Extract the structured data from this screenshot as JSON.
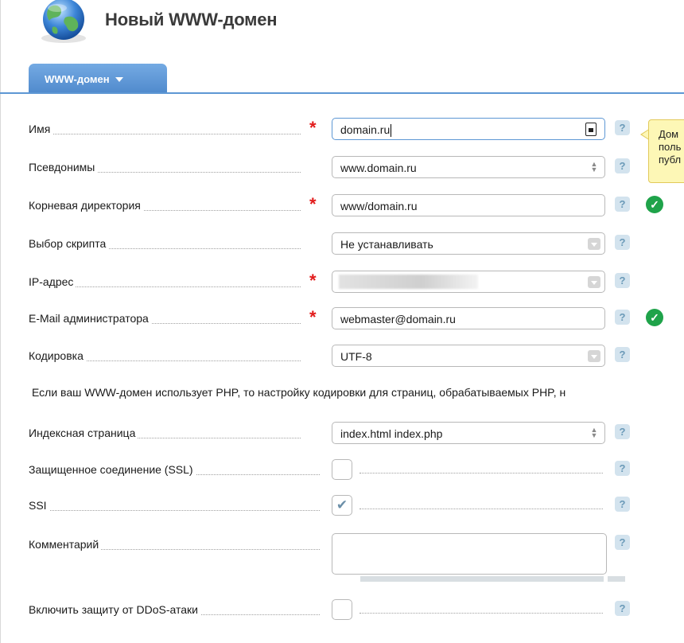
{
  "header": {
    "title": "Новый WWW-домен",
    "icon": "globe-icon"
  },
  "tab": {
    "label": "WWW-домен"
  },
  "form": {
    "name": {
      "label": "Имя",
      "value": "domain.ru",
      "required": true
    },
    "aliases": {
      "label": "Псевдонимы",
      "value": "www.domain.ru"
    },
    "root_dir": {
      "label": "Корневая директория",
      "value": "www/domain.ru",
      "required": true
    },
    "script": {
      "label": "Выбор скрипта",
      "value": "Не устанавливать"
    },
    "ip": {
      "label": "IP-адрес",
      "value": "",
      "required": true
    },
    "email": {
      "label": "E-Mail администратора",
      "value": "webmaster@domain.ru",
      "required": true
    },
    "encoding": {
      "label": "Кодировка",
      "value": "UTF-8"
    },
    "encoding_note": "Если ваш WWW-домен использует PHP, то настройку кодировки для страниц, обрабатываемых PHP, н",
    "index": {
      "label": "Индексная страница",
      "value": "index.html index.php"
    },
    "ssl": {
      "label": "Защищенное соединение (SSL)",
      "checked": false
    },
    "ssi": {
      "label": "SSI",
      "checked": true
    },
    "comment": {
      "label": "Комментарий",
      "value": ""
    },
    "ddos": {
      "label": "Включить защиту от DDoS-атаки",
      "checked": false
    }
  },
  "help_glyph": "?",
  "tooltip": {
    "lines": [
      "Дом",
      "поль",
      "публ"
    ]
  },
  "colors": {
    "accent": "#5d97d4",
    "required": "#e21b1b",
    "ok": "#1fa34a",
    "tooltip_bg": "#fdf7b6"
  }
}
